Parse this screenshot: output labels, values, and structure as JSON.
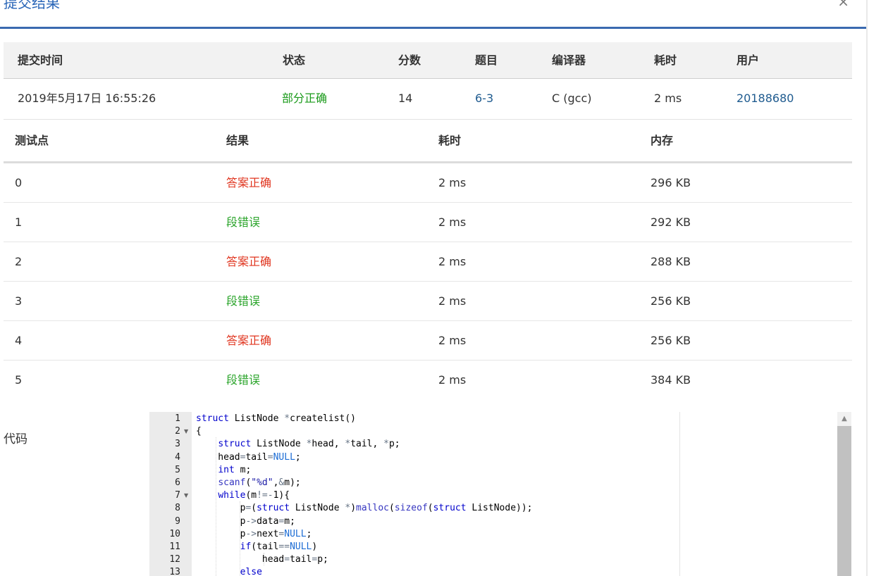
{
  "modal": {
    "title": "提交结果",
    "close_icon": "close-icon",
    "close_glyph": "×"
  },
  "submission": {
    "headers": [
      "提交时间",
      "状态",
      "分数",
      "题目",
      "编译器",
      "耗时",
      "用户"
    ],
    "time": "2019年5月17日 16:55:26",
    "status": "部分正确",
    "score": "14",
    "problem": "6-3",
    "compiler": "C (gcc)",
    "duration": "2 ms",
    "user": "20188680"
  },
  "testcases": {
    "headers": [
      "测试点",
      "结果",
      "耗时",
      "内存"
    ],
    "rows": [
      {
        "id": "0",
        "result": "答案正确",
        "time": "2 ms",
        "memory": "296 KB",
        "ok": true
      },
      {
        "id": "1",
        "result": "段错误",
        "time": "2 ms",
        "memory": "292 KB",
        "ok": false
      },
      {
        "id": "2",
        "result": "答案正确",
        "time": "2 ms",
        "memory": "288 KB",
        "ok": true
      },
      {
        "id": "3",
        "result": "段错误",
        "time": "2 ms",
        "memory": "256 KB",
        "ok": false
      },
      {
        "id": "4",
        "result": "答案正确",
        "time": "2 ms",
        "memory": "256 KB",
        "ok": true
      },
      {
        "id": "5",
        "result": "段错误",
        "time": "2 ms",
        "memory": "384 KB",
        "ok": false
      }
    ]
  },
  "code": {
    "label": "代码",
    "lines": [
      {
        "n": "1",
        "text": "struct ListNode *createlist()",
        "fold": false
      },
      {
        "n": "2",
        "text": "{",
        "fold": true
      },
      {
        "n": "3",
        "text": "    struct ListNode *head, *tail, *p;",
        "fold": false
      },
      {
        "n": "4",
        "text": "    head=tail=NULL;",
        "fold": false
      },
      {
        "n": "5",
        "text": "    int m;",
        "fold": false
      },
      {
        "n": "6",
        "text": "    scanf(\"%d\",&m);",
        "fold": false
      },
      {
        "n": "7",
        "text": "    while(m!=-1){",
        "fold": true
      },
      {
        "n": "8",
        "text": "        p=(struct ListNode *)malloc(sizeof(struct ListNode));",
        "fold": false
      },
      {
        "n": "9",
        "text": "        p->data=m;",
        "fold": false
      },
      {
        "n": "10",
        "text": "        p->next=NULL;",
        "fold": false
      },
      {
        "n": "11",
        "text": "        if(tail==NULL)",
        "fold": false
      },
      {
        "n": "12",
        "text": "            head=tail=p;",
        "fold": false
      },
      {
        "n": "13",
        "text": "        else",
        "fold": false
      }
    ]
  },
  "colors": {
    "accent": "#3a6ab0",
    "partial_ok": "#1a9a1a",
    "accepted": "#e0351f",
    "segfault": "#2ca52c",
    "link": "#1f5b8f"
  }
}
